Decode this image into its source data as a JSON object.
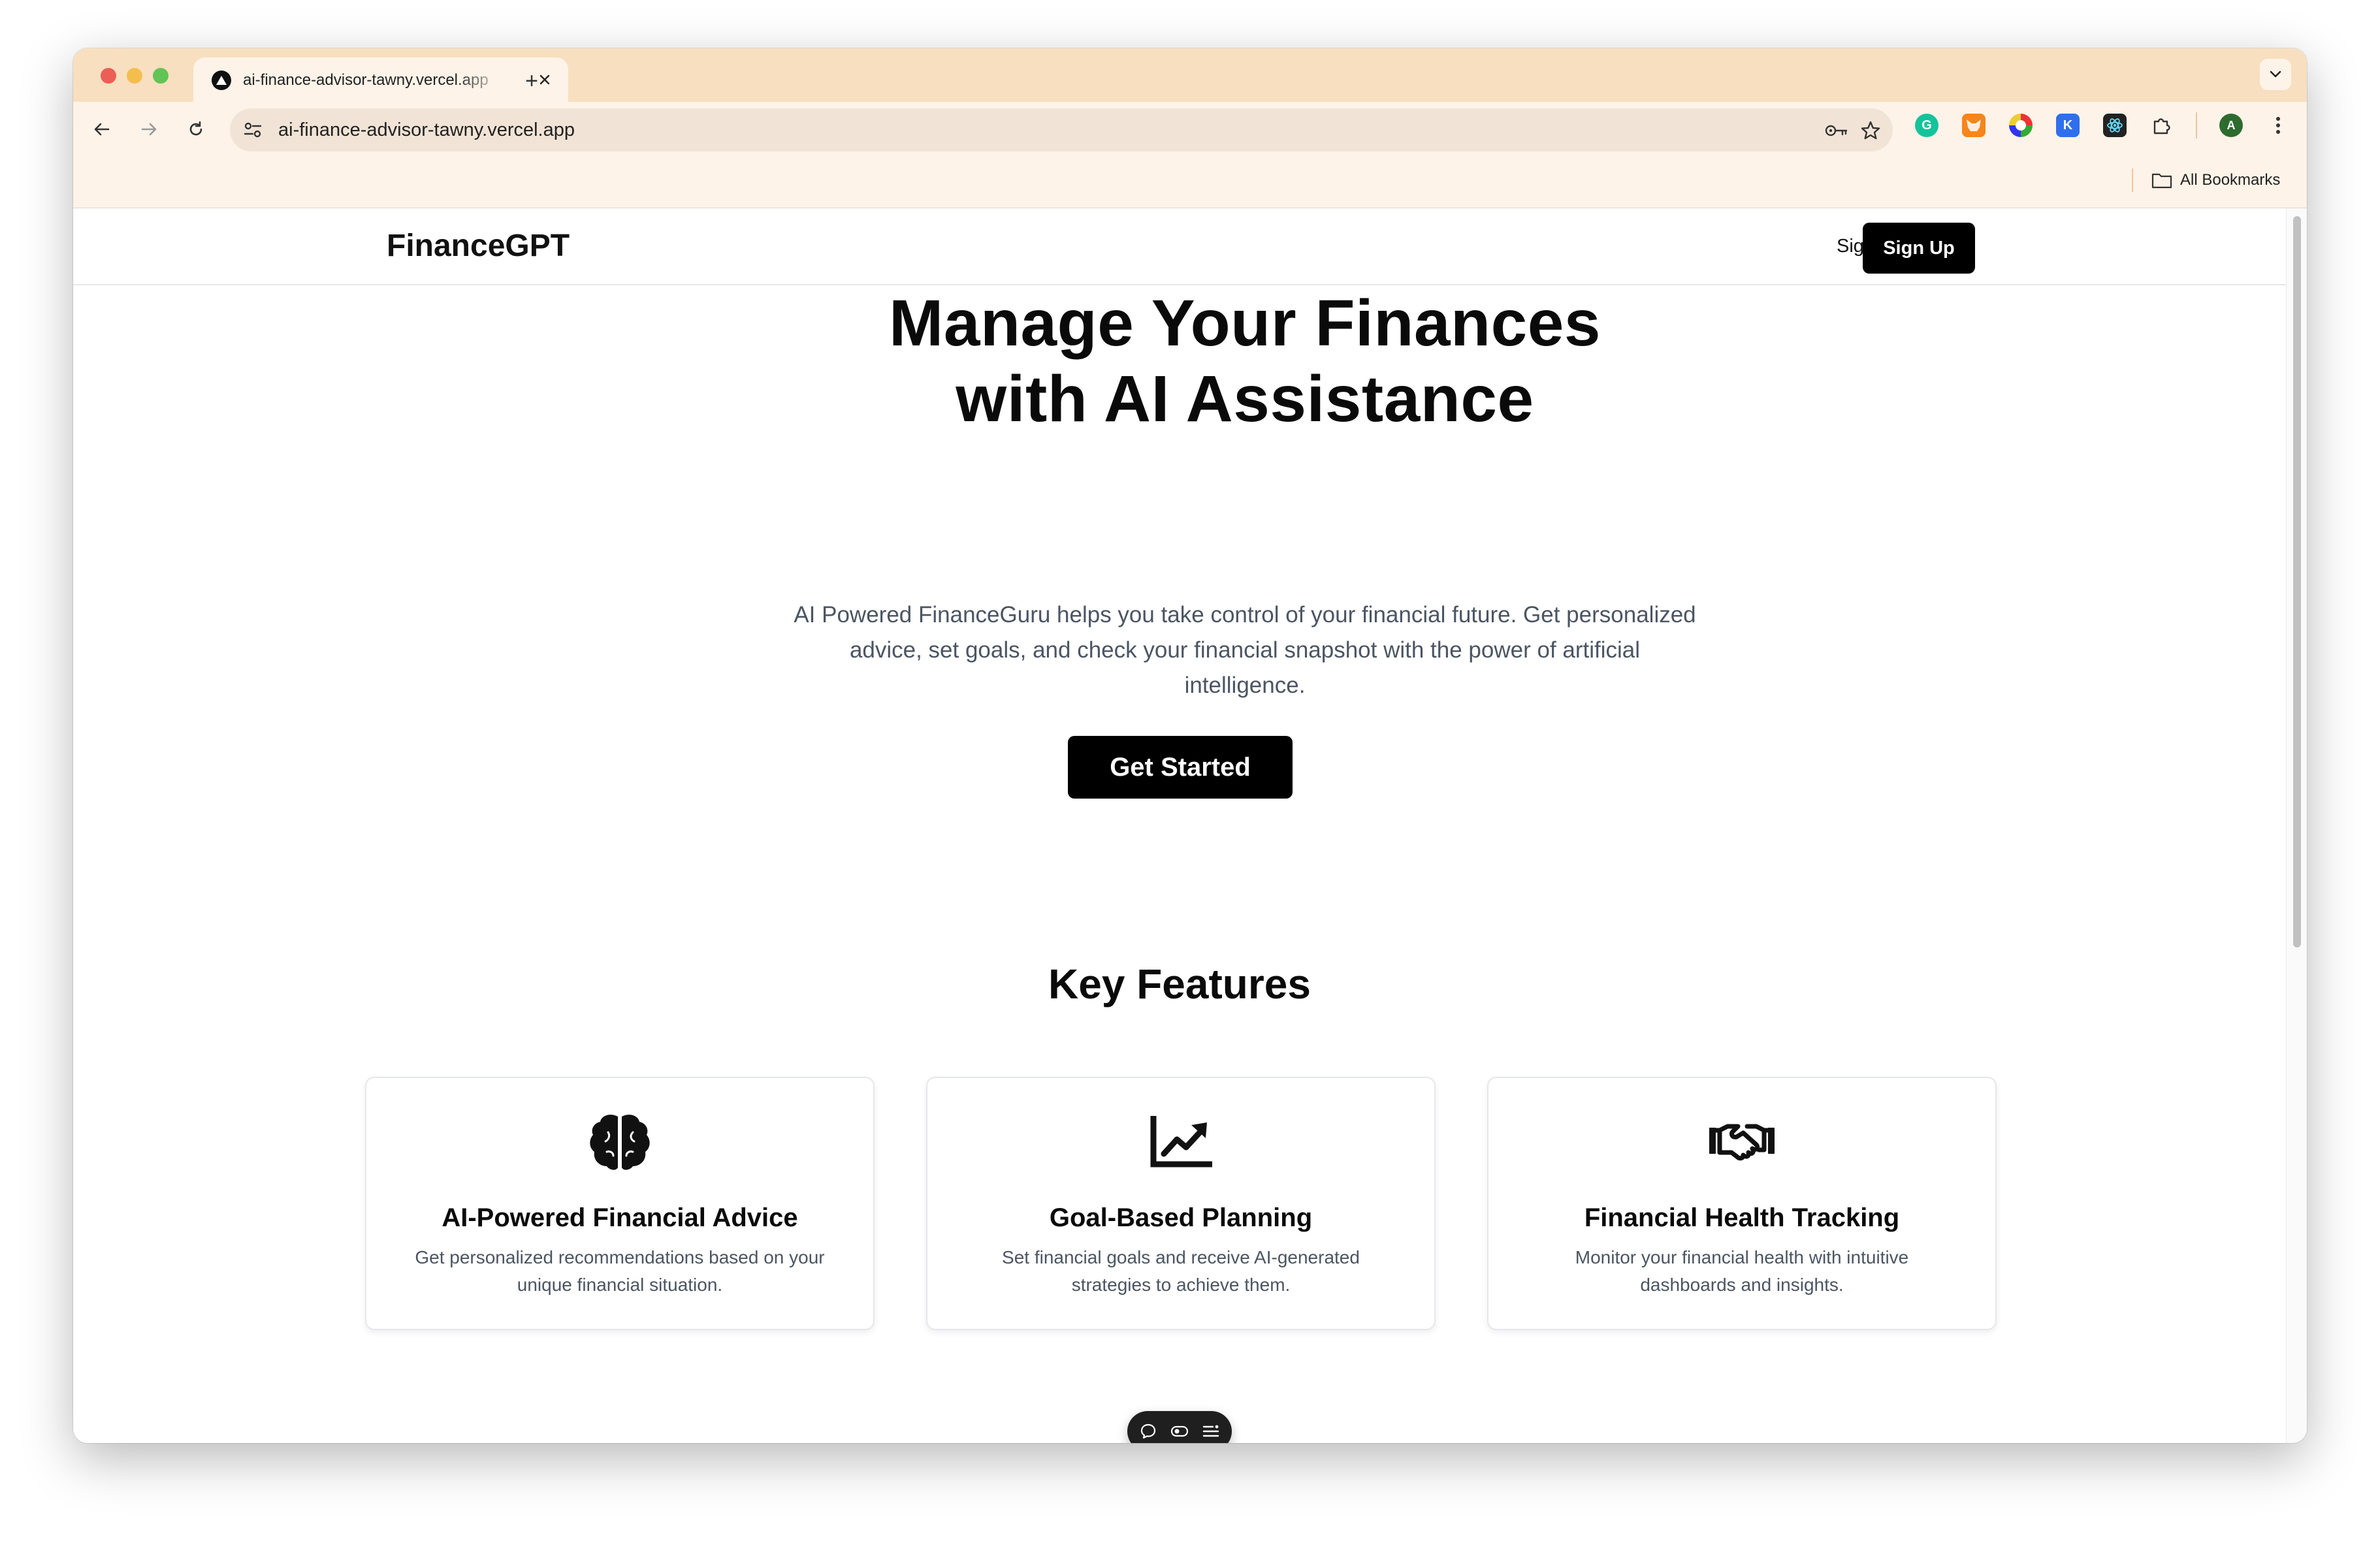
{
  "browser": {
    "tab_title": "ai-finance-advisor-tawny.vercel.app",
    "new_tab_symbol": "+",
    "url": "ai-finance-advisor-tawny.vercel.app",
    "bookmarks_label": "All Bookmarks",
    "profile_initial": "A",
    "extensions": [
      {
        "icon": "grammarly-icon",
        "color": "#15c39a"
      },
      {
        "icon": "metamask-icon",
        "color": "#f6851b"
      },
      {
        "icon": "color-picker-icon",
        "color": "#7b61ff"
      },
      {
        "icon": "k-extension-icon",
        "color": "#2f6fed",
        "letter": "K"
      },
      {
        "icon": "react-devtools-icon",
        "color": "#222222"
      },
      {
        "icon": "extensions-puzzle-icon",
        "color": "#444444"
      }
    ],
    "accent_tabstrip": "#f8dfc0"
  },
  "site": {
    "brand": "FinanceGPT",
    "sign_in": "Sign In",
    "sign_up": "Sign Up",
    "hero": {
      "title_line1": "Manage Your Finances",
      "title_line2": "with AI Assistance",
      "subtitle": "AI Powered FinanceGuru helps you take control of your financial future. Get personalized advice, set goals, and check your financial snapshot with the power of artificial intelligence.",
      "cta": "Get Started"
    },
    "features": {
      "heading": "Key Features",
      "cards": [
        {
          "icon": "brain-icon",
          "title": "AI-Powered Financial Advice",
          "description": "Get personalized recommendations based on your unique financial situation."
        },
        {
          "icon": "chart-line-up-icon",
          "title": "Goal-Based Planning",
          "description": "Set financial goals and receive AI-generated strategies to achieve them."
        },
        {
          "icon": "handshake-icon",
          "title": "Financial Health Tracking",
          "description": "Monitor your financial health with intuitive dashboards and insights."
        }
      ]
    },
    "floating_toolbar": {
      "icons": [
        "comment-icon",
        "toggle-icon",
        "menu-list-icon"
      ]
    }
  }
}
